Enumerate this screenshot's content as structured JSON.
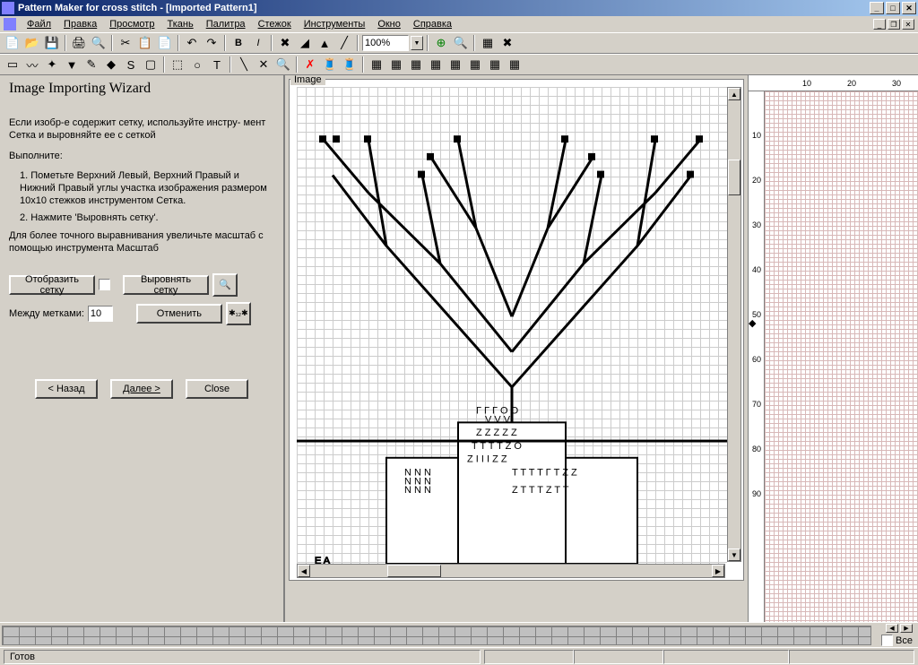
{
  "title": "Pattern Maker for cross stitch - [Imported Pattern1]",
  "menu": {
    "file": "Файл",
    "edit": "Правка",
    "view": "Просмотр",
    "fabric": "Ткань",
    "palette": "Палитра",
    "stitch": "Стежок",
    "tools": "Инструменты",
    "window": "Окно",
    "help": "Справка"
  },
  "zoom": "100%",
  "wizard": {
    "title": "Image Importing Wizard",
    "intro1": "Если изобр-е содержит сетку, используйте инстру- мент Сетка и выровняйте ее с сеткой",
    "do_label": "Выполните:",
    "step1": "1. Пометьте Верхний Левый, Верхний Правый и Нижний Правый углы участка  изображения размером 10x10 стежков инструментом Сетка.",
    "step2": "2. Нажмите 'Выровнять сетку'.",
    "hint": "Для более точного выравнивания увеличьте масштаб с помощью инструмента Масштаб",
    "show_grid": "Отобразить сетку",
    "between_marks": "Между метками:",
    "between_value": "10",
    "align_grid": "Выровнять сетку",
    "cancel": "Отменить",
    "back": "< Назад",
    "next": "Далее >",
    "close": "Close"
  },
  "image_label": "Image",
  "grid_ticks_h": [
    "10",
    "20",
    "30"
  ],
  "grid_ticks_v": [
    "10",
    "20",
    "30",
    "40",
    "50",
    "60",
    "70",
    "80",
    "90"
  ],
  "palette_all": "Все",
  "status": "Готов"
}
